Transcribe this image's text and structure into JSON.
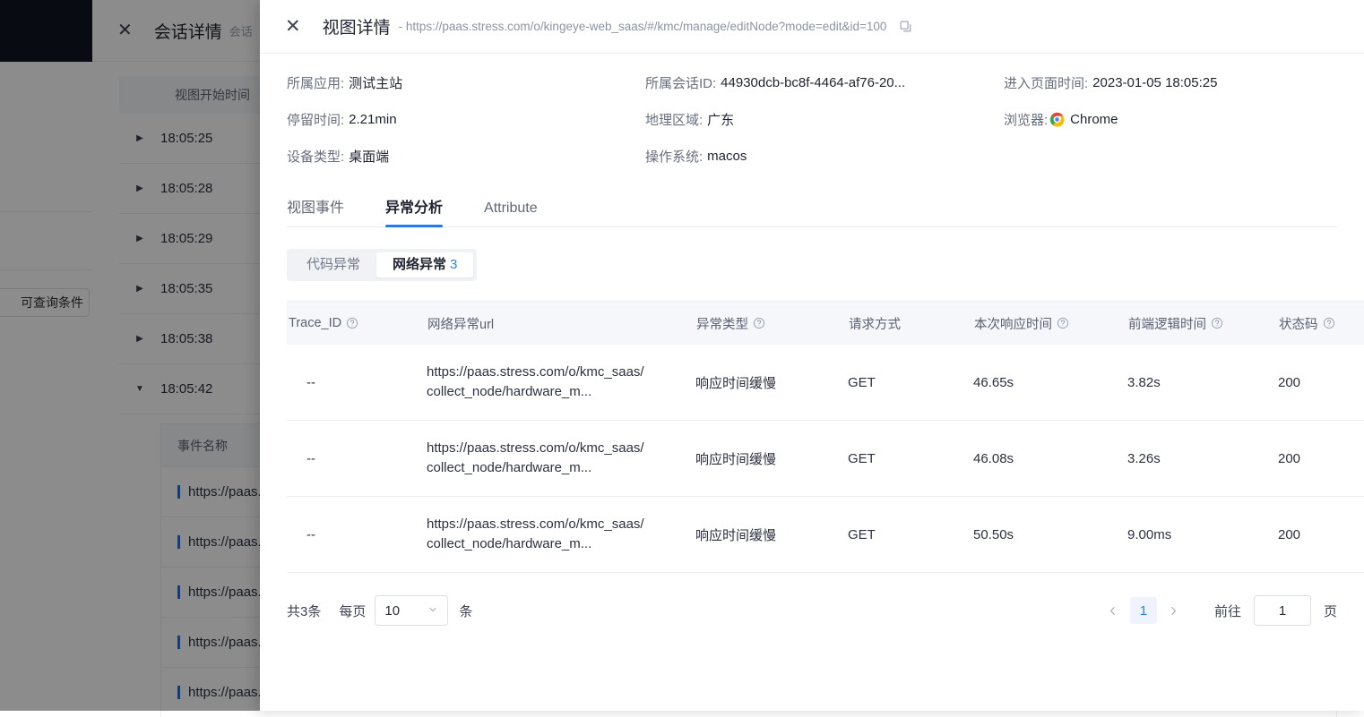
{
  "background": {
    "drawer_title": "会话详情",
    "drawer_subtitle": "会话",
    "close_icon": "close-icon",
    "filter_chip": "可查询条件",
    "table_header": "视图开始时间",
    "rows": [
      {
        "time": "18:05:25",
        "expanded": false
      },
      {
        "time": "18:05:28",
        "expanded": false
      },
      {
        "time": "18:05:29",
        "expanded": false
      },
      {
        "time": "18:05:35",
        "expanded": false
      },
      {
        "time": "18:05:38",
        "expanded": false
      },
      {
        "time": "18:05:42",
        "expanded": true
      }
    ],
    "sub_table_header": "事件名称",
    "sub_rows": [
      "https://paas.",
      "https://paas.",
      "https://paas.",
      "https://paas.",
      "https://paas."
    ]
  },
  "modal": {
    "close_icon": "close-icon",
    "title": "视图详情",
    "url": "- https://paas.stress.com/o/kingeye-web_saas/#/kmc/manage/editNode?mode=edit&id=100",
    "copy_icon": "copy-icon",
    "info": [
      {
        "label": "所属应用:",
        "value": "测试主站"
      },
      {
        "label": "所属会话ID:",
        "value": "44930dcb-bc8f-4464-af76-20..."
      },
      {
        "label": "进入页面时间:",
        "value": "2023-01-05 18:05:25"
      },
      {
        "label": "停留时间:",
        "value": "2.21min"
      },
      {
        "label": "地理区域:",
        "value": "广东"
      },
      {
        "label": "浏览器:",
        "value": "Chrome",
        "icon": "chrome-icon"
      },
      {
        "label": "设备类型:",
        "value": "桌面端"
      },
      {
        "label": "操作系统:",
        "value": "macos"
      }
    ],
    "tabs": [
      {
        "label": "视图事件",
        "active": false
      },
      {
        "label": "异常分析",
        "active": true
      },
      {
        "label": "Attribute",
        "active": false
      }
    ],
    "segmented": [
      {
        "label": "代码异常",
        "count": "",
        "active": false
      },
      {
        "label": "网络异常",
        "count": "3",
        "active": true
      }
    ],
    "table": {
      "columns": [
        {
          "label": "Trace_ID",
          "help": true
        },
        {
          "label": "网络异常url",
          "help": false
        },
        {
          "label": "异常类型",
          "help": true
        },
        {
          "label": "请求方式",
          "help": false
        },
        {
          "label": "本次响应时间",
          "help": true
        },
        {
          "label": "前端逻辑时间",
          "help": true
        },
        {
          "label": "状态码",
          "help": true
        }
      ],
      "rows": [
        {
          "trace_id": "--",
          "url": "https://paas.stress.com/o/kmc_saas/collect_node/hardware_m...",
          "type": "响应时间缓慢",
          "method": "GET",
          "response_time": "46.65s",
          "response_time_alert": true,
          "logic_time": "3.82s",
          "logic_time_alert": true,
          "status": "200"
        },
        {
          "trace_id": "--",
          "url": "https://paas.stress.com/o/kmc_saas/collect_node/hardware_m...",
          "type": "响应时间缓慢",
          "method": "GET",
          "response_time": "46.08s",
          "response_time_alert": true,
          "logic_time": "3.26s",
          "logic_time_alert": true,
          "status": "200"
        },
        {
          "trace_id": "--",
          "url": "https://paas.stress.com/o/kmc_saas/collect_node/hardware_m...",
          "type": "响应时间缓慢",
          "method": "GET",
          "response_time": "50.50s",
          "response_time_alert": true,
          "logic_time": "9.00ms",
          "logic_time_alert": false,
          "status": "200"
        }
      ]
    },
    "pagination": {
      "total": "共3条",
      "per_page_label": "每页",
      "per_page_value": "10",
      "per_page_unit": "条",
      "prev_icon": "chevron-left-icon",
      "next_icon": "chevron-right-icon",
      "pages": [
        "1"
      ],
      "current_page": "1",
      "goto_label": "前往",
      "goto_value": "1",
      "goto_unit": "页"
    }
  },
  "colors": {
    "accent": "#1f7bef",
    "alert": "#f4493c",
    "header_bg": "#f5f7fa",
    "segment_bg": "#f0f2f5"
  }
}
